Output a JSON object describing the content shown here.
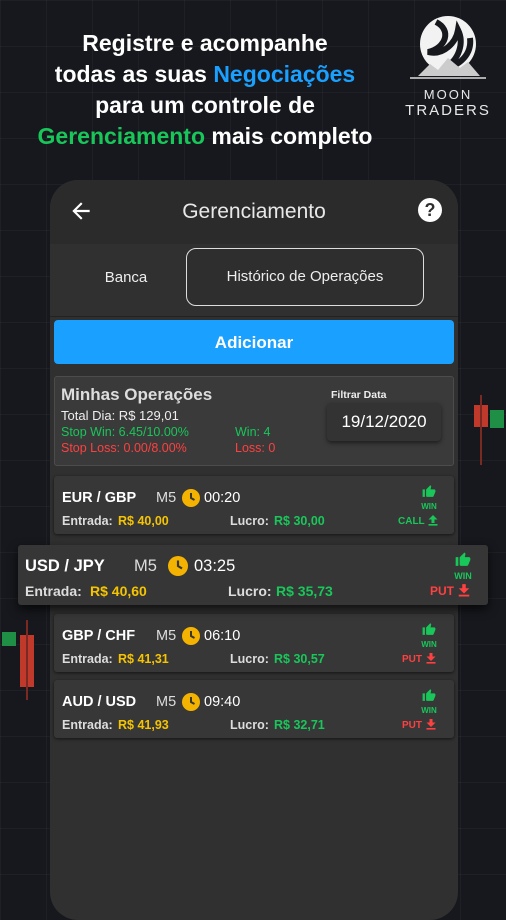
{
  "headline": {
    "line1": "Registre e acompanhe",
    "line2_pre": "todas as suas ",
    "line2_accent": "Negociações",
    "line3": "para um controle de",
    "line4_accent": "Gerenciamento",
    "line4_post": " mais completo"
  },
  "logo": {
    "line1": "MOON",
    "line2": "TRADERS"
  },
  "colors": {
    "blue": "#1aa0ff",
    "green": "#19c65a",
    "red": "#ff4040",
    "yellow": "#f5c400"
  },
  "appbar": {
    "title": "Gerenciamento",
    "help": "?"
  },
  "tabs": {
    "banca": "Banca",
    "historico": "Histórico de Operações"
  },
  "add_button": "Adicionar",
  "summary": {
    "title": "Minhas Operações",
    "total": "Total Dia: R$ 129,01",
    "stop_win": "Stop Win: 6.45/10.00%",
    "stop_loss": "Stop Loss: 0.00/8.00%",
    "win": "Win: 4",
    "loss": "Loss: 0",
    "filter_label": "Filtrar Data",
    "filter_date": "19/12/2020"
  },
  "operations": [
    {
      "pair": "EUR / GBP",
      "tf": "M5",
      "time": "00:20",
      "entrada_label": "Entrada:",
      "entrada": "R$ 40,00",
      "lucro_label": "Lucro:",
      "lucro": "R$ 30,00",
      "result": "WIN",
      "direction": "CALL"
    },
    {
      "pair": "USD / JPY",
      "tf": "M5",
      "time": "03:25",
      "entrada_label": "Entrada:",
      "entrada": "R$ 40,60",
      "lucro_label": "Lucro:",
      "lucro": "R$ 35,73",
      "result": "WIN",
      "direction": "PUT"
    },
    {
      "pair": "GBP / CHF",
      "tf": "M5",
      "time": "06:10",
      "entrada_label": "Entrada:",
      "entrada": "R$ 41,31",
      "lucro_label": "Lucro:",
      "lucro": "R$ 30,57",
      "result": "WIN",
      "direction": "PUT"
    },
    {
      "pair": "AUD / USD",
      "tf": "M5",
      "time": "09:40",
      "entrada_label": "Entrada:",
      "entrada": "R$ 41,93",
      "lucro_label": "Lucro:",
      "lucro": "R$ 32,71",
      "result": "WIN",
      "direction": "PUT"
    }
  ]
}
